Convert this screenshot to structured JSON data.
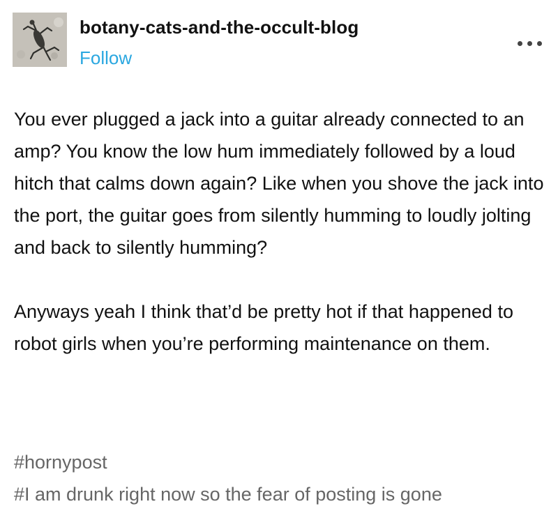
{
  "post": {
    "blog_name": "botany-cats-and-the-occult-blog",
    "follow_label": "Follow",
    "menu_icon": "ellipsis-icon",
    "avatar_icon": "avatar-lizard-image",
    "paragraphs": [
      "You ever plugged a jack into a guitar already connected to an amp? You know the low hum immediately followed by a loud hitch that calms down again? Like when you shove the jack into the port, the guitar goes from silently humming to loudly jolting and back to silently humming?",
      "Anyways yeah I think that’d be pretty hot if that happened to robot girls when you’re performing maintenance on them."
    ],
    "tags": [
      "#hornypost",
      "#I am drunk right now so the fear of posting is gone"
    ]
  },
  "colors": {
    "follow": "#2aa7e0",
    "tag": "#666666",
    "text": "#111111"
  }
}
